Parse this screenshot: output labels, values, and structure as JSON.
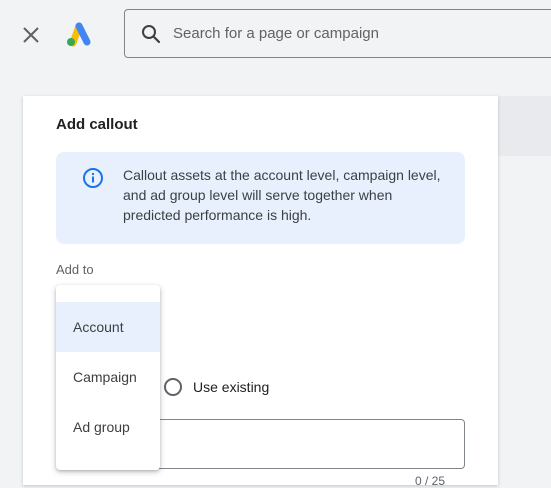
{
  "header": {
    "close_icon": "close-icon",
    "logo_icon": "google-ads-logo",
    "search": {
      "placeholder": "Search for a page or campaign",
      "value": "",
      "icon": "search-icon"
    }
  },
  "panel": {
    "title": "Add callout",
    "info": {
      "icon": "info-icon",
      "text": "Callout assets at the account level, campaign level, and ad group level will serve together when predicted performance is high."
    },
    "add_to_label": "Add to",
    "use_existing_label": "Use existing",
    "callout_text_value": "",
    "char_count": "0 / 25"
  },
  "dropdown": {
    "options": [
      "Account",
      "Campaign",
      "Ad group"
    ],
    "selected": "Account"
  },
  "colors": {
    "info_background": "#e8f0fe",
    "selected_option_background": "#e8f0fe",
    "logo_blue": "#4285f4",
    "logo_yellow": "#fbbc04",
    "logo_green": "#34a853"
  }
}
